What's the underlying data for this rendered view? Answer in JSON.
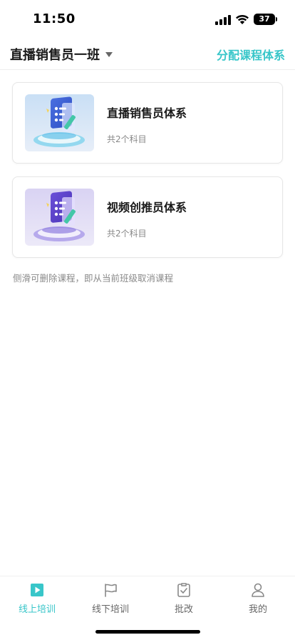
{
  "status_bar": {
    "time": "11:50",
    "battery": "37"
  },
  "header": {
    "class_name": "直播销售员一班",
    "assign_label": "分配课程体系"
  },
  "courses": [
    {
      "title": "直播销售员体系",
      "subtitle": "共2个科目"
    },
    {
      "title": "视频创推员体系",
      "subtitle": "共2个科目"
    }
  ],
  "hint": "侧滑可删除课程，即从当前班级取消课程",
  "tabs": [
    {
      "label": "线上培训",
      "icon": "play-icon",
      "active": true
    },
    {
      "label": "线下培训",
      "icon": "flag-icon",
      "active": false
    },
    {
      "label": "批改",
      "icon": "check-doc-icon",
      "active": false
    },
    {
      "label": "我的",
      "icon": "user-icon",
      "active": false
    }
  ],
  "colors": {
    "accent": "#38c6c9",
    "text": "#1a1a1a",
    "muted": "#888888"
  }
}
